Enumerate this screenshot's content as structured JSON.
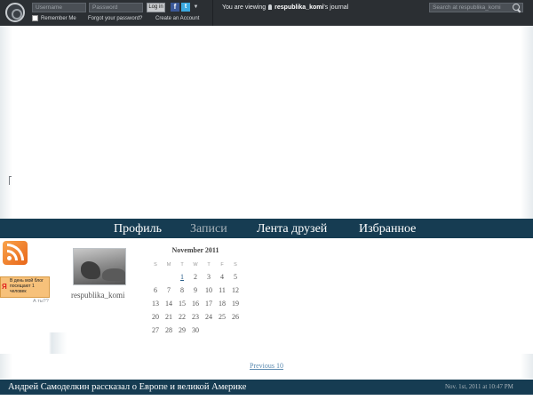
{
  "topbar": {
    "username_placeholder": "Username",
    "password_placeholder": "Password",
    "login_label": "Log in",
    "facebook_icon": "facebook-icon",
    "twitter_icon": "twitter-icon",
    "remember_me": "Remember Me",
    "forgot_password": "Forgot your password?",
    "create_account": "Create an Account",
    "viewing_prefix": "You are viewing",
    "viewing_user": "respublika_komi",
    "viewing_suffix": "'s journal",
    "search_placeholder": "Search at respublika_komi"
  },
  "nav": {
    "items": [
      "Профиль",
      "Записи",
      "Лента друзей",
      "Избранное"
    ],
    "active": "Записи"
  },
  "sidebar": {
    "rss_icon": "rss-icon",
    "ya_widget_text": "В день мой блог посещают 1 человек",
    "ya_letter": "Я",
    "ya_link": "А ты??"
  },
  "profile": {
    "username": "respublika_komi"
  },
  "calendar": {
    "title": "November 2011",
    "weekdays": [
      "S",
      "M",
      "T",
      "W",
      "T",
      "F",
      "S"
    ],
    "weeks": [
      [
        "",
        "",
        "1",
        "2",
        "3",
        "4",
        "5"
      ],
      [
        "6",
        "7",
        "8",
        "9",
        "10",
        "11",
        "12"
      ],
      [
        "13",
        "14",
        "15",
        "16",
        "17",
        "18",
        "19"
      ],
      [
        "20",
        "21",
        "22",
        "23",
        "24",
        "25",
        "26"
      ],
      [
        "27",
        "28",
        "29",
        "30",
        "",
        "",
        ""
      ]
    ],
    "linked_days": [
      "1"
    ]
  },
  "pager": {
    "previous": "Previous 10"
  },
  "entry": {
    "title": "Андрей Самоделкин рассказал о Европе и великой Америке",
    "date": "Nov. 1st, 2011 at 10:47 PM"
  },
  "colors": {
    "nav_bg": "#163c52",
    "topbar_bg": "#2b2f33",
    "link": "#5b8ab0"
  }
}
